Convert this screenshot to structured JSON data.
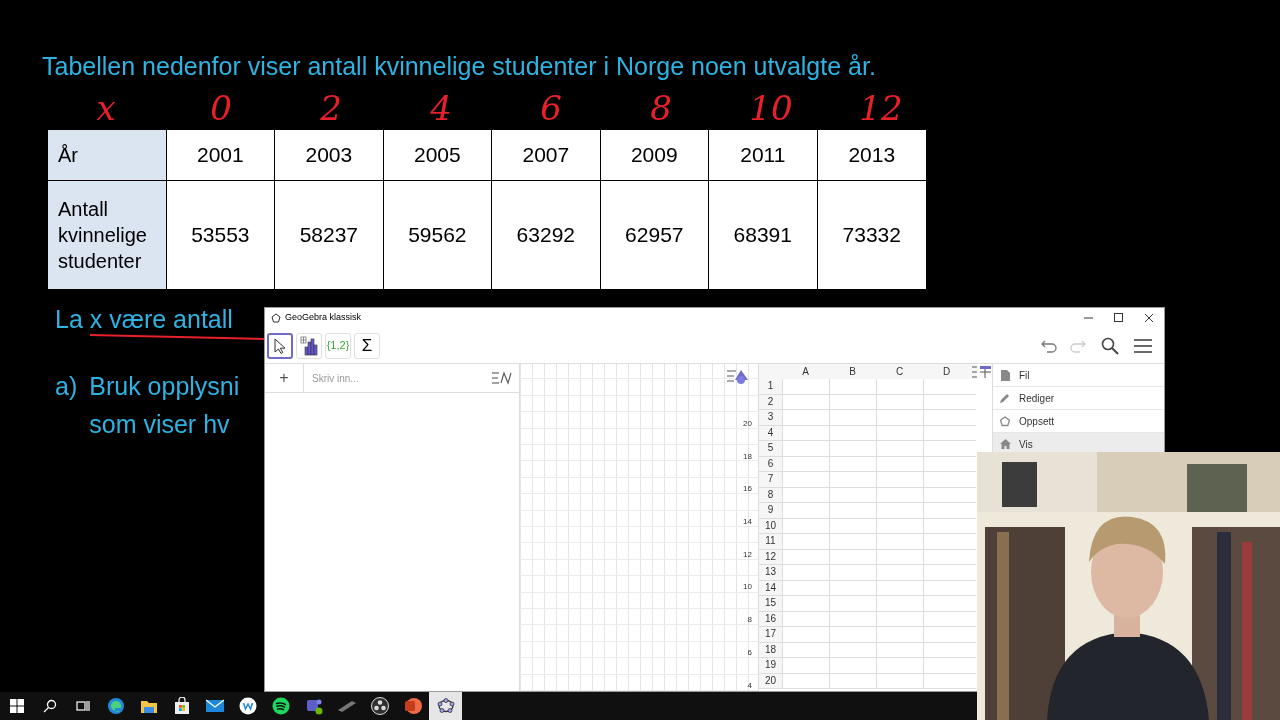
{
  "slide": {
    "title": "Tabellen nedenfor viser antall kvinnelige studenter i Norge noen utvalgte år.",
    "annotations": [
      "x",
      "0",
      "2",
      "4",
      "6",
      "8",
      "10",
      "12"
    ],
    "table": {
      "rows": [
        {
          "header": "År",
          "cells": [
            "2001",
            "2003",
            "2005",
            "2007",
            "2009",
            "2011",
            "2013"
          ]
        },
        {
          "header": "Antall kvinnelige studenter",
          "cells": [
            "53553",
            "58237",
            "59562",
            "63292",
            "62957",
            "68391",
            "73332"
          ]
        }
      ]
    },
    "intro": "La x være antall",
    "task": {
      "label": "a)",
      "lines": [
        "Bruk opplysni",
        "som viser hv"
      ]
    }
  },
  "geogebra": {
    "title": "GeoGebra klassisk",
    "tools": [
      {
        "kind": "pointer",
        "selected": true
      },
      {
        "kind": "chart",
        "selected": false
      },
      {
        "kind": "list",
        "label": "{1,2}",
        "selected": false
      },
      {
        "kind": "sum",
        "label": "Σ",
        "selected": false
      }
    ],
    "algebra": {
      "add": "+",
      "placeholder": "Skriv inn..."
    },
    "graphics": {
      "y_ticks": [
        "20",
        "18",
        "16",
        "14",
        "12",
        "10",
        "8",
        "6",
        "4"
      ]
    },
    "spreadsheet": {
      "columns": [
        "A",
        "B",
        "C",
        "D"
      ],
      "rows": [
        "1",
        "2",
        "3",
        "4",
        "5",
        "6",
        "7",
        "8",
        "9",
        "10",
        "11",
        "12",
        "13",
        "14",
        "15",
        "16",
        "17",
        "18",
        "19",
        "20"
      ]
    },
    "menu": [
      {
        "kind": "file",
        "label": "Fil",
        "selected": false
      },
      {
        "kind": "edit",
        "label": "Rediger",
        "selected": false
      },
      {
        "kind": "layout",
        "label": "Oppsett",
        "selected": false
      },
      {
        "kind": "view",
        "label": "Vis",
        "selected": true
      }
    ]
  },
  "taskbar": [
    {
      "kind": "start",
      "selected": false
    },
    {
      "kind": "search",
      "selected": false
    },
    {
      "kind": "taskview",
      "selected": false
    },
    {
      "kind": "browser",
      "selected": false
    },
    {
      "kind": "folder",
      "selected": false
    },
    {
      "kind": "store",
      "selected": false
    },
    {
      "kind": "mail",
      "selected": false
    },
    {
      "kind": "w",
      "selected": false
    },
    {
      "kind": "music",
      "selected": false
    },
    {
      "kind": "teams",
      "selected": false
    },
    {
      "kind": "pen",
      "selected": false
    },
    {
      "kind": "record",
      "selected": false
    },
    {
      "kind": "slides",
      "selected": false
    },
    {
      "kind": "geogebra",
      "selected": true
    }
  ]
}
